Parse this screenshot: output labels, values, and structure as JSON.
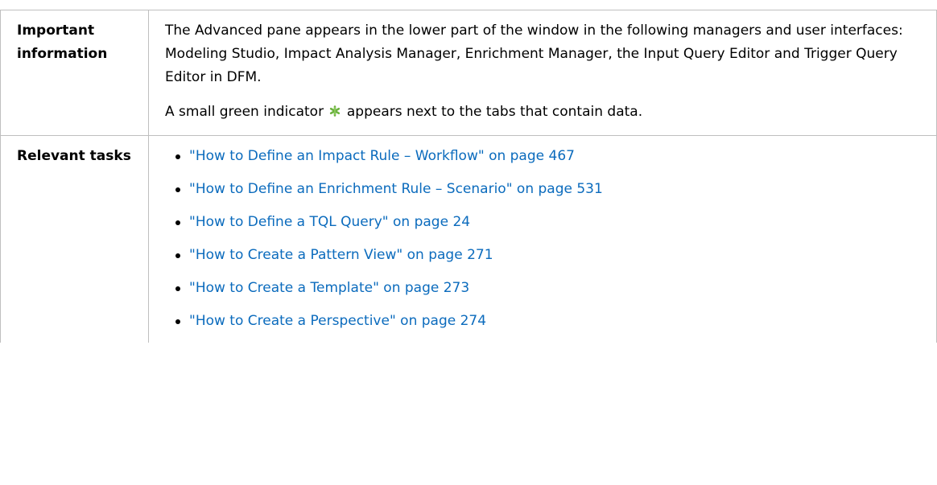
{
  "rows": {
    "important": {
      "label": "Important information",
      "paragraph1": "The Advanced pane appears in the lower part of the window in the following managers and user interfaces: Modeling Studio, Impact Analysis Manager, Enrichment Manager, the Input Query Editor and Trigger Query Editor in DFM.",
      "paragraph2_before": "A small green indicator",
      "paragraph2_after": "appears next to the tabs that contain data.",
      "indicator_icon": "green-asterisk-icon",
      "indicator_color": "#6db33f"
    },
    "tasks": {
      "label": "Relevant tasks",
      "items": [
        {
          "text": "\"How to Define an Impact Rule – Workflow\" on page 467"
        },
        {
          "text": "\"How to Define an Enrichment Rule – Scenario\" on page 531"
        },
        {
          "text": "\"How to Define a TQL Query\" on page 24"
        },
        {
          "text": "\"How to Create a Pattern View\" on page 271"
        },
        {
          "text": "\"How to Create a Template\" on page 273"
        },
        {
          "text": "\"How to Create a Perspective\" on page 274"
        }
      ],
      "link_color": "#0b6bbd"
    }
  }
}
